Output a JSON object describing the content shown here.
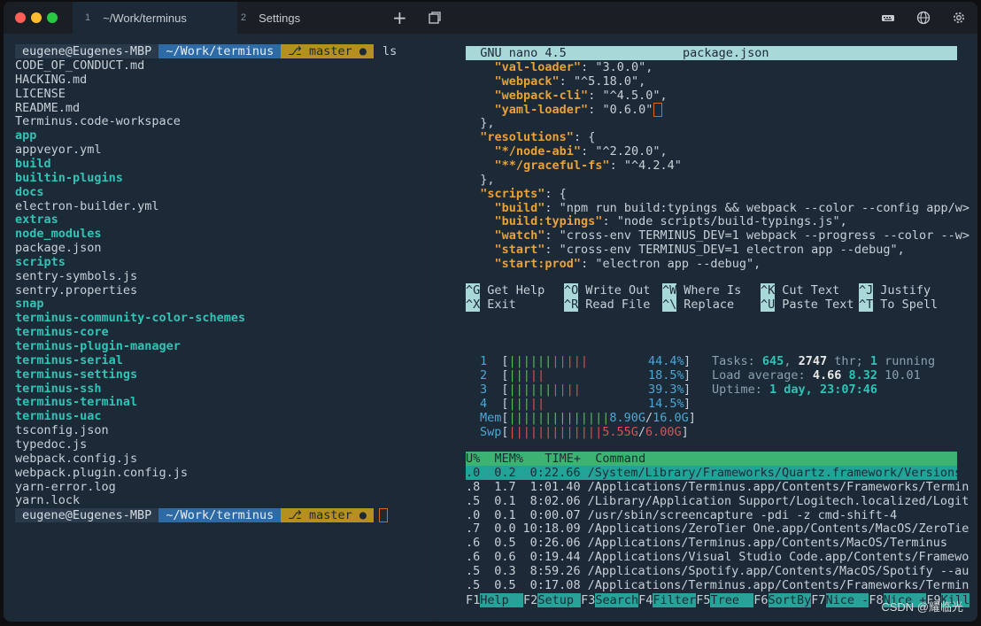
{
  "tabs": [
    {
      "num": "1",
      "label": "~/Work/terminus"
    },
    {
      "num": "2",
      "label": "Settings"
    }
  ],
  "toolbar_icons": [
    "plus-icon",
    "restore-icon",
    "keyboard-icon",
    "globe-icon",
    "gear-icon"
  ],
  "prompt": {
    "user": "eugene@Eugenes-MBP",
    "dir": "~/Work/terminus",
    "branch": "master",
    "status_dot": "●",
    "git_glyph": "⎇",
    "command": "ls"
  },
  "files": [
    {
      "name": "CODE_OF_CONDUCT.md",
      "dir": false
    },
    {
      "name": "HACKING.md",
      "dir": false
    },
    {
      "name": "LICENSE",
      "dir": false
    },
    {
      "name": "README.md",
      "dir": false
    },
    {
      "name": "Terminus.code-workspace",
      "dir": false
    },
    {
      "name": "app",
      "dir": true
    },
    {
      "name": "appveyor.yml",
      "dir": false
    },
    {
      "name": "build",
      "dir": true
    },
    {
      "name": "builtin-plugins",
      "dir": true
    },
    {
      "name": "docs",
      "dir": true
    },
    {
      "name": "electron-builder.yml",
      "dir": false
    },
    {
      "name": "extras",
      "dir": true
    },
    {
      "name": "node_modules",
      "dir": true
    },
    {
      "name": "package.json",
      "dir": false
    },
    {
      "name": "scripts",
      "dir": true
    },
    {
      "name": "sentry-symbols.js",
      "dir": false
    },
    {
      "name": "sentry.properties",
      "dir": false
    },
    {
      "name": "snap",
      "dir": true
    },
    {
      "name": "terminus-community-color-schemes",
      "dir": true
    },
    {
      "name": "terminus-core",
      "dir": true
    },
    {
      "name": "terminus-plugin-manager",
      "dir": true
    },
    {
      "name": "terminus-serial",
      "dir": true
    },
    {
      "name": "terminus-settings",
      "dir": true
    },
    {
      "name": "terminus-ssh",
      "dir": true
    },
    {
      "name": "terminus-terminal",
      "dir": true
    },
    {
      "name": "terminus-uac",
      "dir": true
    },
    {
      "name": "tsconfig.json",
      "dir": false
    },
    {
      "name": "typedoc.js",
      "dir": false
    },
    {
      "name": "webpack.config.js",
      "dir": false
    },
    {
      "name": "webpack.plugin.config.js",
      "dir": false
    },
    {
      "name": "yarn-error.log",
      "dir": false
    },
    {
      "name": "yarn.lock",
      "dir": false
    }
  ],
  "nano": {
    "header_left": "  GNU nano 4.5",
    "header_file": "package.json",
    "lines": [
      {
        "indent": "    ",
        "key": "\"val-loader\"",
        "rest": ": \"3.0.0\","
      },
      {
        "indent": "    ",
        "key": "\"webpack\"",
        "rest": ": \"^5.18.0\","
      },
      {
        "indent": "    ",
        "key": "\"webpack-cli\"",
        "rest": ": \"^4.5.0\","
      },
      {
        "indent": "    ",
        "key": "\"yaml-loader\"",
        "rest": ": \"0.6.0\""
      },
      {
        "indent": "  ",
        "key": "",
        "rest": "},"
      },
      {
        "indent": "  ",
        "key": "\"resolutions\"",
        "rest": ": {"
      },
      {
        "indent": "    ",
        "key": "\"*/node-abi\"",
        "rest": ": \"^2.20.0\","
      },
      {
        "indent": "    ",
        "key": "\"**/graceful-fs\"",
        "rest": ": \"^4.2.4\""
      },
      {
        "indent": "  ",
        "key": "",
        "rest": "},"
      },
      {
        "indent": "  ",
        "key": "\"scripts\"",
        "rest": ": {"
      },
      {
        "indent": "    ",
        "key": "\"build\"",
        "rest": ": \"npm run build:typings && webpack --color --config app/w>"
      },
      {
        "indent": "    ",
        "key": "\"build:typings\"",
        "rest": ": \"node scripts/build-typings.js\","
      },
      {
        "indent": "    ",
        "key": "\"watch\"",
        "rest": ": \"cross-env TERMINUS_DEV=1 webpack --progress --color --w>"
      },
      {
        "indent": "    ",
        "key": "\"start\"",
        "rest": ": \"cross-env TERMINUS_DEV=1 electron app --debug\","
      },
      {
        "indent": "    ",
        "key": "\"start:prod\"",
        "rest": ": \"electron app --debug\","
      }
    ],
    "shortcuts_row1": [
      {
        "key": "^G",
        "label": "Get Help"
      },
      {
        "key": "^O",
        "label": "Write Out"
      },
      {
        "key": "^W",
        "label": "Where Is"
      },
      {
        "key": "^K",
        "label": "Cut Text"
      },
      {
        "key": "^J",
        "label": "Justify"
      }
    ],
    "shortcuts_row2": [
      {
        "key": "^X",
        "label": "Exit"
      },
      {
        "key": "^R",
        "label": "Read File"
      },
      {
        "key": "^\\",
        "label": "Replace"
      },
      {
        "key": "^U",
        "label": "Paste Text"
      },
      {
        "key": "^T",
        "label": "To Spell"
      }
    ]
  },
  "htop": {
    "cpus": [
      {
        "id": "1",
        "bars_g": "||||||",
        "bars_r": "|||||",
        "pct": "44.4%"
      },
      {
        "id": "2",
        "bars_g": "|||",
        "bars_r": "||",
        "pct": "18.5%"
      },
      {
        "id": "3",
        "bars_g": "||||||",
        "bars_r": "||||",
        "pct": "39.3%"
      },
      {
        "id": "4",
        "bars_g": "|||",
        "bars_r": "||",
        "pct": "14.5%"
      }
    ],
    "mem": {
      "label": "Mem",
      "bars": "||||||||||||||",
      "used": "8.90G",
      "total": "16.0G"
    },
    "swp": {
      "label": "Swp",
      "bars": "|||||||||||||",
      "used": "5.55G",
      "total": "6.00G"
    },
    "tasks_label": "Tasks:",
    "tasks": "645",
    "thr": "2747",
    "thr_label": "thr;",
    "running": "1",
    "running_label": "running",
    "load_label": "Load average:",
    "load1": "4.66",
    "load5": "8.32",
    "load15": "10.01",
    "uptime_label": "Uptime:",
    "uptime": "1 day, 23:07:46",
    "columns": "U%  MEM%   TIME+  Command",
    "processes": [
      {
        "cpu": ".0",
        "mem": "0.2",
        "time": "0:22.66",
        "cmd": "/System/Library/Frameworks/Quartz.framework/Versions/"
      },
      {
        "cpu": ".8",
        "mem": "1.7",
        "time": "1:01.40",
        "cmd": "/Applications/Terminus.app/Contents/Frameworks/Termin"
      },
      {
        "cpu": ".5",
        "mem": "0.1",
        "time": "8:02.06",
        "cmd": "/Library/Application Support/Logitech.localized/Logit"
      },
      {
        "cpu": ".0",
        "mem": "0.1",
        "time": "0:00.07",
        "cmd": "/usr/sbin/screencapture -pdi -z cmd-shift-4"
      },
      {
        "cpu": ".7",
        "mem": "0.0",
        "time": "10:18.09",
        "cmd": "/Applications/ZeroTier One.app/Contents/MacOS/ZeroTie"
      },
      {
        "cpu": ".6",
        "mem": "0.5",
        "time": "0:26.06",
        "cmd": "/Applications/Terminus.app/Contents/MacOS/Terminus"
      },
      {
        "cpu": ".6",
        "mem": "0.6",
        "time": "0:19.44",
        "cmd": "/Applications/Visual Studio Code.app/Contents/Framewo"
      },
      {
        "cpu": ".5",
        "mem": "0.3",
        "time": "8:59.26",
        "cmd": "/Applications/Spotify.app/Contents/MacOS/Spotify --au"
      },
      {
        "cpu": ".5",
        "mem": "0.5",
        "time": "0:17.08",
        "cmd": "/Applications/Terminus.app/Contents/Frameworks/Termin"
      }
    ],
    "fkeys": [
      {
        "k": "F1",
        "label": "Help  "
      },
      {
        "k": "F2",
        "label": "Setup "
      },
      {
        "k": "F3",
        "label": "Search"
      },
      {
        "k": "F4",
        "label": "Filter"
      },
      {
        "k": "F5",
        "label": "Tree  "
      },
      {
        "k": "F6",
        "label": "SortBy"
      },
      {
        "k": "F7",
        "label": "Nice -"
      },
      {
        "k": "F8",
        "label": "Nice +"
      },
      {
        "k": "F9",
        "label": "Kill"
      }
    ]
  },
  "watermark": "CSDN @耀临光",
  "colors": {
    "accent": "#2ec4b6",
    "dir": "#2d6aa6",
    "git": "#b59020"
  }
}
